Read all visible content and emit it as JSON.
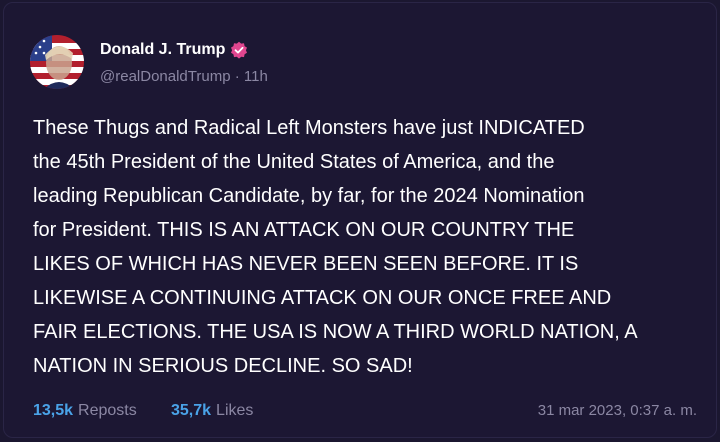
{
  "post": {
    "author_name": "Donald J. Trump",
    "handle": "@realDonaldTrump",
    "separator": " · ",
    "age": "11h",
    "verified_icon": "verified-badge-icon",
    "accent_color": "#e0468f",
    "text": "These Thugs and Radical Left Monsters have just INDICATED\nthe 45th President of the United States of America, and the\nleading Republican Candidate, by far, for the 2024 Nomination\nfor President. THIS IS AN ATTACK ON OUR COUNTRY THE\nLIKES OF WHICH HAS NEVER BEEN SEEN BEFORE. IT IS\nLIKEWISE A CONTINUING ATTACK ON OUR ONCE FREE AND\nFAIR ELECTIONS. THE USA IS NOW A THIRD WORLD NATION, A\nNATION IN SERIOUS DECLINE. SO SAD!"
  },
  "footer": {
    "reposts_count": "13,5k",
    "reposts_label": "Reposts",
    "likes_count": "35,7k",
    "likes_label": "Likes",
    "timestamp": "31 mar 2023, 0:37 a. m.",
    "count_color": "#4aa3e8"
  }
}
